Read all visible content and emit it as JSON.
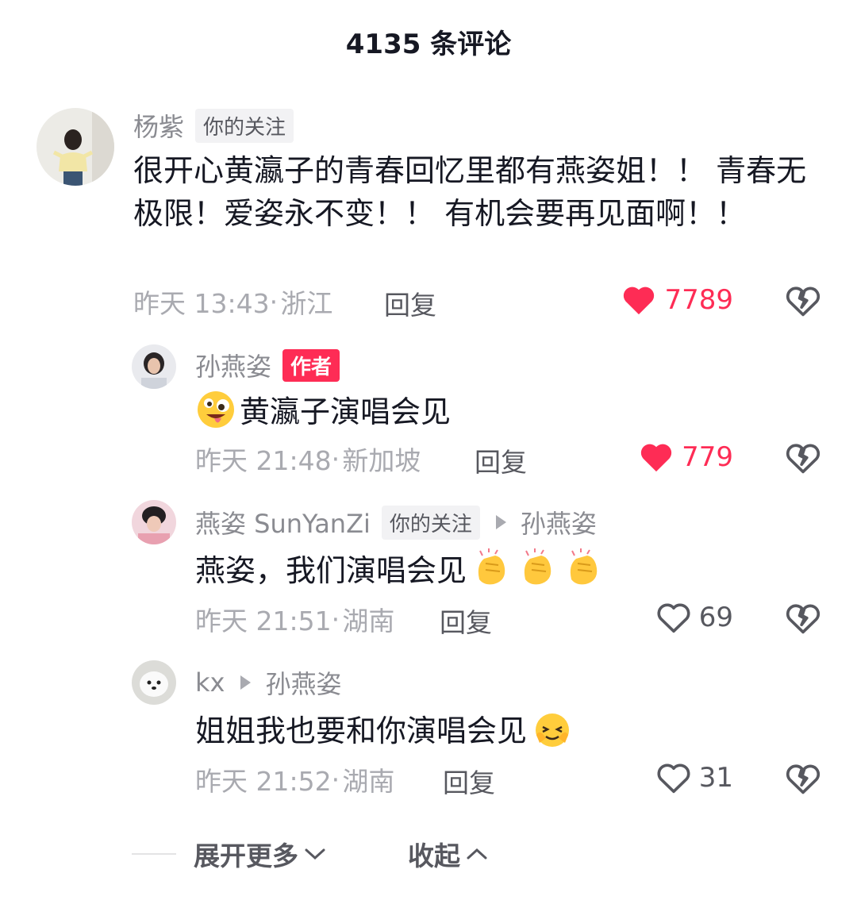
{
  "header": {
    "title": "4135 条评论"
  },
  "comments": [
    {
      "username": "杨紫",
      "tag": "你的关注",
      "text": "很开心黄瀛子的青春回忆里都有燕姿姐！！ 青春无极限！爱姿永不变！！ 有机会要再见面啊！！",
      "time": "昨天 13:43",
      "location": "浙江",
      "reply_label": "回复",
      "likes": "7789",
      "liked": true
    }
  ],
  "replies": [
    {
      "username": "孙燕姿",
      "tag": "作者",
      "emoji": "zany-face-emoji",
      "text": "黄瀛子演唱会见",
      "time": "昨天 21:48",
      "location": "新加坡",
      "reply_label": "回复",
      "likes": "779",
      "liked": true
    },
    {
      "username": "燕姿 SunYanZi",
      "tag": "你的关注",
      "reply_to": "孙燕姿",
      "text": "燕姿，我们演唱会见",
      "emoji": "clapping-hands-emoji",
      "time": "昨天 21:51",
      "location": "湖南",
      "reply_label": "回复",
      "likes": "69",
      "liked": false
    },
    {
      "username": "kx",
      "reply_to": "孙燕姿",
      "text": "姐姐我也要和你演唱会见",
      "emoji": "smiling-face-emoji",
      "time": "昨天 21:52",
      "location": "湖南",
      "reply_label": "回复",
      "likes": "31",
      "liked": false
    }
  ],
  "footer": {
    "expand_label": "展开更多",
    "collapse_label": "收起"
  },
  "colors": {
    "accent": "#fe2c55",
    "muted": "#a9aab0",
    "text": "#161823",
    "tag_bg": "#f2f2f4"
  }
}
